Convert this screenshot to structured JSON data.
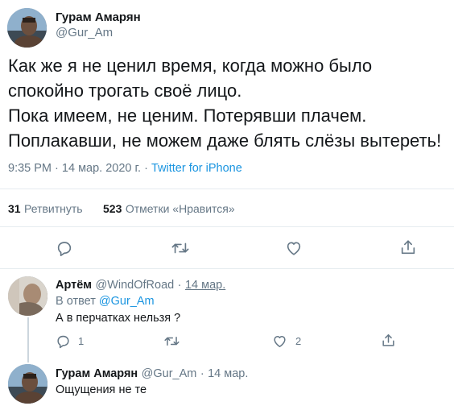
{
  "main_tweet": {
    "author_name": "Гурам Амарян",
    "author_handle": "@Gur_Am",
    "lines": [
      "Как же я не ценил время, когда можно было",
      "спокойно трогать своё лицо.",
      "Пока имеем, не ценим. Потерявши плачем.",
      "Поплакавши, не можем даже блять слёзы вытереть!"
    ],
    "time": "9:35 PM",
    "separator": "·",
    "date": "14 мар. 2020 г.",
    "source": "Twitter for iPhone",
    "retweets_count": "31",
    "retweets_label": "Ретвитнуть",
    "likes_count": "523",
    "likes_label": "Отметки «Нравится»"
  },
  "replies": [
    {
      "author_name": "Артём",
      "author_handle": "@WindOfRoad",
      "separator": "·",
      "date": "14 мар.",
      "reply_to_prefix": "В ответ",
      "reply_to_handle": "@Gur_Am",
      "text": "А в перчатках нельзя ?",
      "reply_count": "1",
      "retweet_count": "",
      "like_count": "2"
    },
    {
      "author_name": "Гурам Амарян",
      "author_handle": "@Gur_Am",
      "separator": "·",
      "date": "14 мар.",
      "text": "Ощущения не те"
    }
  ],
  "icons": [
    "reply-icon",
    "retweet-icon",
    "like-icon",
    "share-icon"
  ],
  "colors": {
    "link": "#1b95e0",
    "secondary": "#657786",
    "divider": "#e6ecf0"
  }
}
